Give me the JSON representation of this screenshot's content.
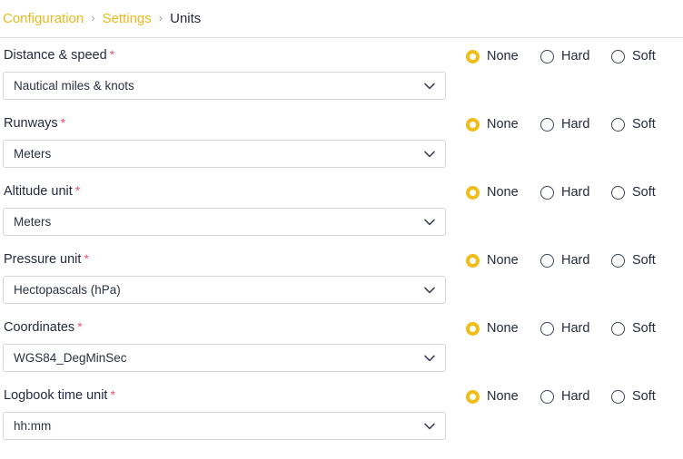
{
  "breadcrumb": {
    "separator": "›",
    "items": [
      {
        "label": "Configuration",
        "current": false
      },
      {
        "label": "Settings",
        "current": false
      },
      {
        "label": "Units",
        "current": true
      }
    ]
  },
  "colors": {
    "link": "#e8b81f",
    "current": "#232b3e",
    "required": "#f0526d",
    "radio_selected": "#efbe18",
    "radio_border": "#3b4457",
    "field_border": "#d3d5dd"
  },
  "form": {
    "required_mark": "*",
    "rows": [
      {
        "label": "Distance & speed",
        "required": true,
        "value": "Nautical miles & knots",
        "options": [
          {
            "label": "None",
            "selected": true
          },
          {
            "label": "Hard",
            "selected": false
          },
          {
            "label": "Soft",
            "selected": false
          }
        ]
      },
      {
        "label": "Runways",
        "required": true,
        "value": "Meters",
        "options": [
          {
            "label": "None",
            "selected": true
          },
          {
            "label": "Hard",
            "selected": false
          },
          {
            "label": "Soft",
            "selected": false
          }
        ]
      },
      {
        "label": "Altitude unit",
        "required": true,
        "value": "Meters",
        "options": [
          {
            "label": "None",
            "selected": true
          },
          {
            "label": "Hard",
            "selected": false
          },
          {
            "label": "Soft",
            "selected": false
          }
        ]
      },
      {
        "label": "Pressure unit",
        "required": true,
        "value": "Hectopascals (hPa)",
        "options": [
          {
            "label": "None",
            "selected": true
          },
          {
            "label": "Hard",
            "selected": false
          },
          {
            "label": "Soft",
            "selected": false
          }
        ]
      },
      {
        "label": "Coordinates",
        "required": true,
        "value": "WGS84_DegMinSec",
        "options": [
          {
            "label": "None",
            "selected": true
          },
          {
            "label": "Hard",
            "selected": false
          },
          {
            "label": "Soft",
            "selected": false
          }
        ]
      },
      {
        "label": "Logbook time unit",
        "required": true,
        "value": "hh:mm",
        "options": [
          {
            "label": "None",
            "selected": true
          },
          {
            "label": "Hard",
            "selected": false
          },
          {
            "label": "Soft",
            "selected": false
          }
        ]
      }
    ]
  },
  "icons": {
    "chevron_down": "chevron-down-icon",
    "breadcrumb_separator": "chevron-right-icon"
  }
}
